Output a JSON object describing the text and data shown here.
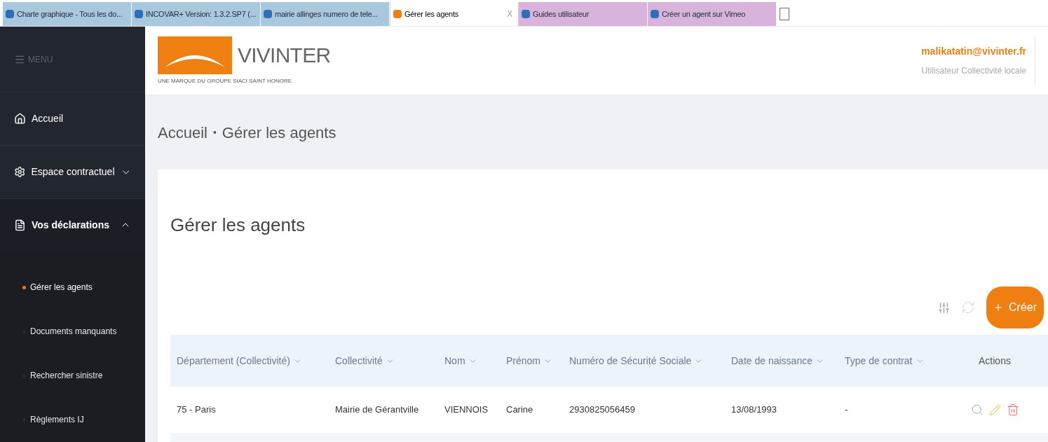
{
  "browser_tabs": [
    {
      "label": "Charte graphique - Tous les do...",
      "selected": false,
      "color": "#a9c7dd"
    },
    {
      "label": "INCOVAR+ Version: 1.3.2.SP7 (...",
      "selected": false,
      "color": "#a9c7dd"
    },
    {
      "label": "mairie allinges numero de tele...",
      "selected": false,
      "color": "#a9c7dd"
    },
    {
      "label": "Gérer les agents",
      "selected": true,
      "color": "#ffffff",
      "close": "X"
    },
    {
      "label": "Guides utilisateur",
      "selected": false,
      "color": "#d8b4dc"
    },
    {
      "label": "Créer un agent sur Vimeo",
      "selected": false,
      "color": "#d8b4dc"
    }
  ],
  "sidebar": {
    "menu_label": "MENU",
    "items": [
      {
        "label": "Accueil",
        "kind": "home",
        "selected": false
      },
      {
        "label": "Espace contractuel",
        "kind": "gear",
        "expanded": false,
        "selected": false
      },
      {
        "label": "Vos déclarations",
        "kind": "document",
        "expanded": true,
        "selected": true,
        "children": [
          {
            "label": "Gérer les agents",
            "selected": true
          },
          {
            "label": "Documents manquants",
            "selected": false
          },
          {
            "label": "Rechercher sinistre",
            "selected": false
          },
          {
            "label": "Règlements IJ",
            "selected": false
          }
        ]
      }
    ]
  },
  "header": {
    "brand": "VIVINTER",
    "tagline": "UNE MARQUE DU GROUPE SIACI SAINT HONORE",
    "user_email": "malikatatin@vivinter.fr",
    "user_role": "Utilisateur Collectivité locale"
  },
  "breadcrumb": [
    "Accueil",
    "Gérer les agents"
  ],
  "breadcrumb_separator": "•",
  "page_title": "Gérer les agents",
  "create_button": "Créer",
  "table": {
    "columns": [
      "Département (Collectivité)",
      "Collectivité",
      "Nom",
      "Prénom",
      "Numéro de Sécurité Sociale",
      "Date de naissance",
      "Type de contrat",
      "Actions"
    ],
    "rows": [
      [
        "75 - Paris",
        "Mairie de Gérantville",
        "VIENNOIS",
        "Carine",
        "2930825056459",
        "13/08/1993",
        "-"
      ]
    ]
  }
}
